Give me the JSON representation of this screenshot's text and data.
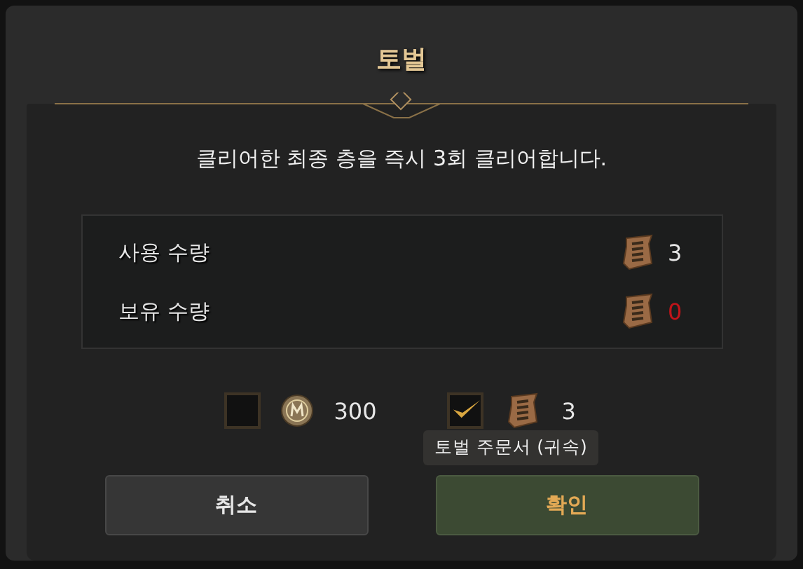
{
  "dialog": {
    "title": "토벌",
    "description": "클리어한 최종 층을 즉시 3회 클리어합니다."
  },
  "quantities": [
    {
      "label": "사용 수량",
      "value": "3",
      "insufficient": false
    },
    {
      "label": "보유 수량",
      "value": "0",
      "insufficient": true
    }
  ],
  "costs": [
    {
      "kind": "coin",
      "amount": "300",
      "checked": false
    },
    {
      "kind": "scroll",
      "amount": "3",
      "checked": true
    }
  ],
  "tooltip": "토벌 주문서 (귀속)",
  "buttons": [
    {
      "label": "취소",
      "kind": "cancel"
    },
    {
      "label": "확인",
      "kind": "confirm"
    }
  ]
}
